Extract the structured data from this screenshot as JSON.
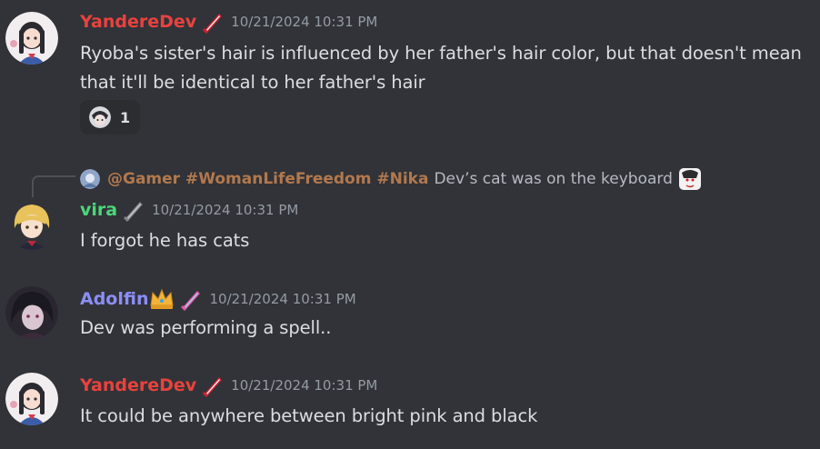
{
  "messages": [
    {
      "author": "YandereDev",
      "author_color": "#e9423d",
      "role_icon": "sword-icon",
      "timestamp": "10/21/2024 10:31 PM",
      "text": "Ryoba's sister's hair is influenced by her father's hair color, but that doesn't mean that it'll be identical to her father's hair",
      "reaction": {
        "emoji": "anime-face-emoji",
        "count": "1"
      }
    },
    {
      "reply_to": {
        "author": "@Gamer #WomanLifeFreedom #Nika",
        "text": "Dev’s cat was on the keyboard"
      },
      "author": "vira",
      "author_color": "#4cd779",
      "role_icon": "sword-icon",
      "timestamp": "10/21/2024 10:31 PM",
      "text": "I forgot he has cats"
    },
    {
      "author": "Adolfin",
      "author_color": "#8b8ef4",
      "role_icon": "sword-icon",
      "badge": "crown-icon",
      "timestamp": "10/21/2024 10:31 PM",
      "text": "Dev was performing a spell.."
    },
    {
      "author": "YandereDev",
      "author_color": "#e9423d",
      "role_icon": "sword-icon",
      "timestamp": "10/21/2024 10:31 PM",
      "text": "It could be anywhere between bright pink and black"
    }
  ],
  "colors": {
    "background": "#313338",
    "text": "#dbdee1",
    "timestamp": "#949ba4",
    "reaction_bg": "#2b2d31"
  }
}
